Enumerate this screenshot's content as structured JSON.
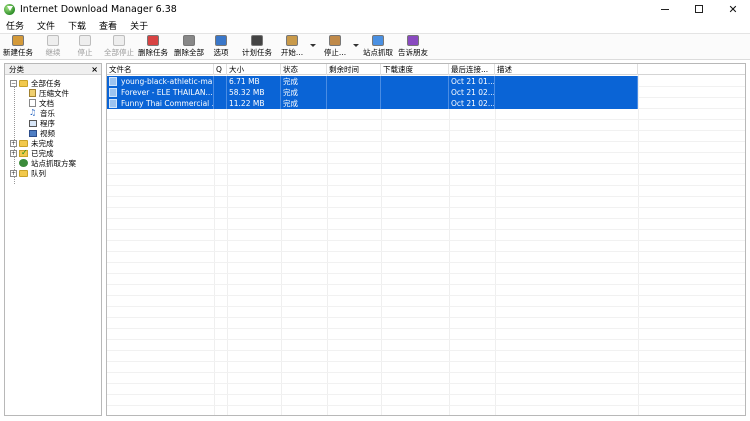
{
  "window": {
    "title": "Internet Download Manager 6.38"
  },
  "menu": [
    "任务",
    "文件",
    "下载",
    "查看",
    "关于"
  ],
  "toolbar": [
    {
      "label": "新建任务",
      "icon": "new-task-icon",
      "color": "#d49a3a",
      "disabled": false
    },
    {
      "label": "继续",
      "icon": "resume-icon",
      "color": "#cccccc",
      "disabled": true
    },
    {
      "label": "停止",
      "icon": "stop-icon",
      "color": "#cccccc",
      "disabled": true
    },
    {
      "label": "全部停止",
      "icon": "stop-all-icon",
      "color": "#cccccc",
      "disabled": true
    },
    {
      "label": "删除任务",
      "icon": "delete-task-icon",
      "color": "#d84343",
      "disabled": false
    },
    {
      "label": "删除全部",
      "icon": "delete-all-icon",
      "color": "#888888",
      "disabled": false
    },
    {
      "label": "选项",
      "icon": "options-icon",
      "color": "#3a77c9",
      "disabled": false
    },
    {
      "label": "计划任务",
      "icon": "scheduler-icon",
      "color": "#444444",
      "disabled": false
    },
    {
      "label": "开始...",
      "icon": "start-queue-icon",
      "color": "#c99a4a",
      "disabled": false
    },
    {
      "label": "停止...",
      "icon": "stop-queue-icon",
      "color": "#c08a4a",
      "disabled": false
    },
    {
      "label": "站点抓取",
      "icon": "site-grabber-icon",
      "color": "#4a90e2",
      "disabled": false
    },
    {
      "label": "告诉朋友",
      "icon": "tell-friend-icon",
      "color": "#8a4ac0",
      "disabled": false
    }
  ],
  "sidebar": {
    "header": "分类",
    "close": "×",
    "tree": [
      {
        "label": "全部任务",
        "level": 0,
        "icon": "folder-icon",
        "expander": "−"
      },
      {
        "label": "压缩文件",
        "level": 1,
        "icon": "zip-icon"
      },
      {
        "label": "文档",
        "level": 1,
        "icon": "doc-icon"
      },
      {
        "label": "音乐",
        "level": 1,
        "icon": "music-icon"
      },
      {
        "label": "程序",
        "level": 1,
        "icon": "program-icon"
      },
      {
        "label": "视频",
        "level": 1,
        "icon": "video-icon"
      },
      {
        "label": "未完成",
        "level": 0,
        "icon": "folder-icon",
        "expander": "+"
      },
      {
        "label": "已完成",
        "level": 0,
        "icon": "completed-folder-icon",
        "expander": "+"
      },
      {
        "label": "站点抓取方案",
        "level": 0,
        "icon": "grabber-icon"
      },
      {
        "label": "队列",
        "level": 0,
        "icon": "folder-icon",
        "expander": "+"
      }
    ]
  },
  "list": {
    "columns": [
      "文件名",
      "Q",
      "大小",
      "状态",
      "剩余时间",
      "下载速度",
      "最后连接...",
      "描述"
    ],
    "rows": [
      {
        "name": "young-black-athletic-ma...",
        "q": "",
        "size": "6.71  MB",
        "status": "完成",
        "remaining": "",
        "speed": "",
        "last": "Oct 21 01...",
        "desc": ""
      },
      {
        "name": "Forever  - ELE THAILAN...",
        "q": "",
        "size": "58.32  MB",
        "status": "完成",
        "remaining": "",
        "speed": "",
        "last": "Oct 21 02...",
        "desc": ""
      },
      {
        "name": "Funny Thai Commercial ...",
        "q": "",
        "size": "11.22  MB",
        "status": "完成",
        "remaining": "",
        "speed": "",
        "last": "Oct 21 02...",
        "desc": ""
      }
    ]
  },
  "colors": {
    "selection": "#0a64d6",
    "folder": "#f2c94c"
  }
}
